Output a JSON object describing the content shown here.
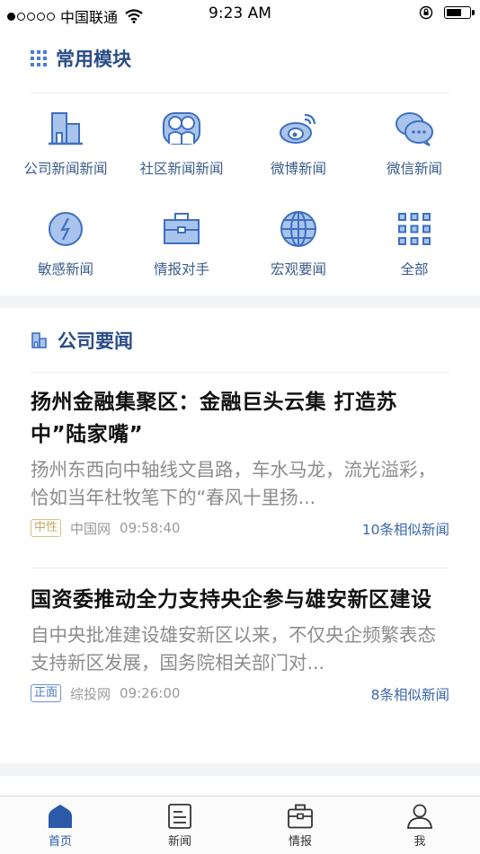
{
  "status_bar": {
    "carrier": "中国联通",
    "time": "9:23 AM",
    "battery_level": 0.7
  },
  "modules": {
    "title": "常用模块",
    "items": [
      {
        "label": "公司新闻新闻",
        "icon": "building-icon"
      },
      {
        "label": "社区新闻新闻",
        "icon": "community-icon"
      },
      {
        "label": "微博新闻",
        "icon": "weibo-icon"
      },
      {
        "label": "微信新闻",
        "icon": "wechat-icon"
      },
      {
        "label": "敏感新闻",
        "icon": "sensitive-icon"
      },
      {
        "label": "情报对手",
        "icon": "briefcase-icon"
      },
      {
        "label": "宏观要闻",
        "icon": "globe-icon"
      },
      {
        "label": "全部",
        "icon": "grid-icon"
      }
    ]
  },
  "company_news": {
    "title": "公司要闻",
    "articles": [
      {
        "title": "扬州金融集聚区：金融巨头云集 打造苏中”陆家嘴”",
        "summary": "扬州东西向中轴线文昌路，车水马龙，流光溢彩，恰如当年杜牧笔下的“春风十里扬...",
        "sentiment": "中性",
        "source": "中国网",
        "time": "09:58:40",
        "similar": "10条相似新闻"
      },
      {
        "title": "国资委推动全力支持央企参与雄安新区建设",
        "summary": "自中央批准建设雄安新区以来，不仅央企频繁表态支持新区发展，国务院相关部门对...",
        "sentiment": "正面",
        "source": "综投网",
        "time": "09:26:00",
        "similar": "8条相似新闻"
      }
    ]
  },
  "tab_bar": {
    "tabs": [
      {
        "label": "首页",
        "active": true
      },
      {
        "label": "新闻",
        "active": false
      },
      {
        "label": "情报",
        "active": false
      },
      {
        "label": "我",
        "active": false
      }
    ]
  },
  "colors": {
    "accent": "#2a5aa8",
    "section_title": "#2a4d86",
    "icon_fill": "#a9c4ec",
    "icon_stroke": "#3e6fc0"
  }
}
